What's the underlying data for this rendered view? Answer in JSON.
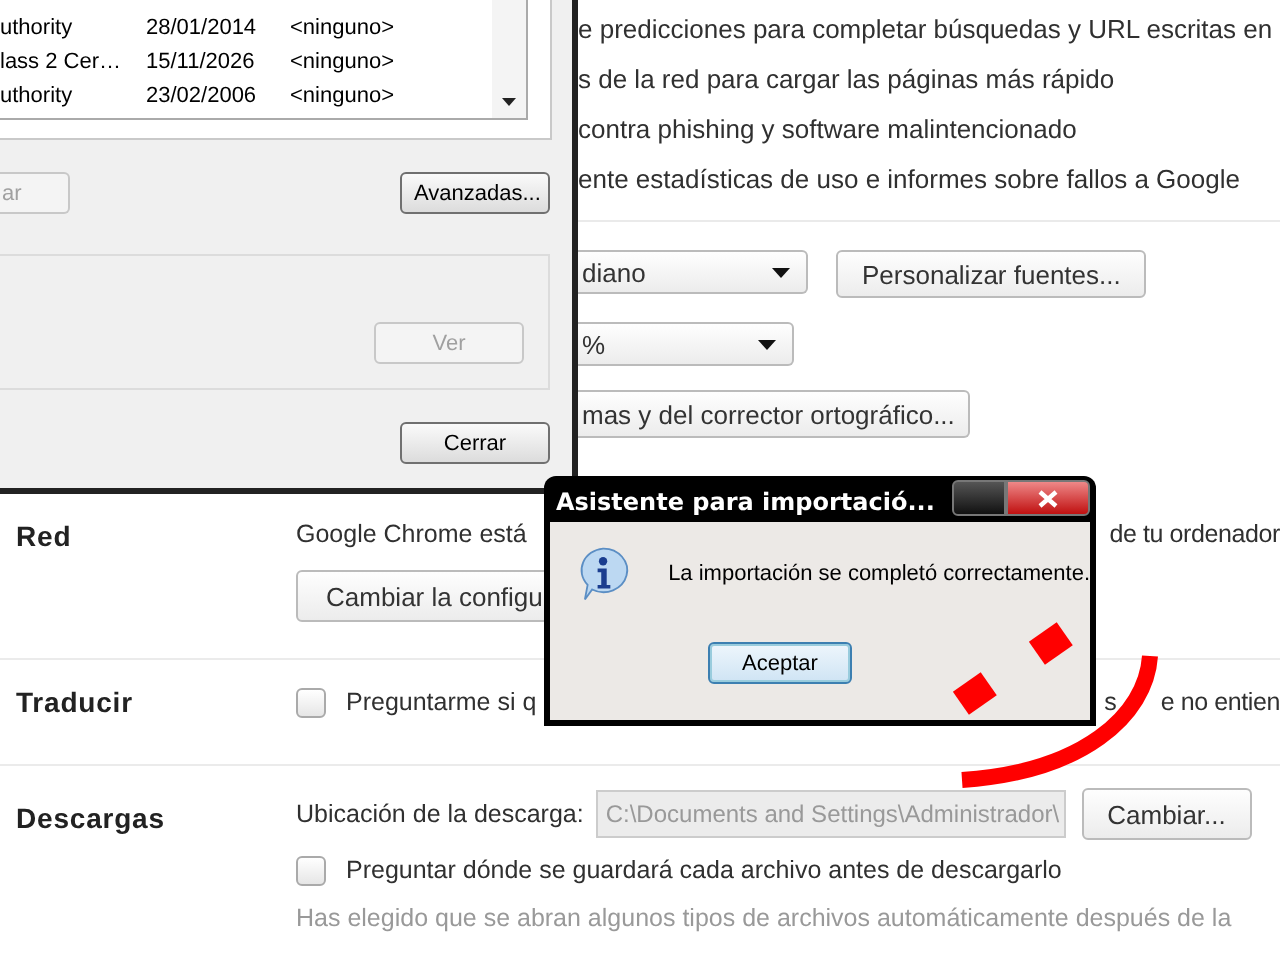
{
  "certificate_dialog": {
    "rows": [
      {
        "cells": [
          "uthority",
          "28/01/2014",
          "<ninguno>"
        ]
      },
      {
        "cells": [
          "lass 2 Cer…",
          "15/11/2026",
          "<ninguno>"
        ]
      },
      {
        "cells": [
          "uthority",
          "23/02/2006",
          "<ninguno>"
        ]
      }
    ],
    "left_button": {
      "label": "ar",
      "disabled": true
    },
    "advanced_button": {
      "label": "Avanzadas...",
      "disabled": false
    },
    "view_button": {
      "label": "Ver",
      "disabled": true
    },
    "close_button": {
      "label": "Cerrar",
      "disabled": false
    }
  },
  "settings_top": {
    "lines": [
      "e predicciones para completar búsquedas y URL escritas en",
      "s de la red para cargar las páginas más rápido",
      "contra phishing y software malintencionado",
      "ente estadísticas de uso e informes sobre fallos a Google"
    ],
    "font_size_select": "diano",
    "customize_fonts_button": "Personalizar fuentes...",
    "zoom_select": "%",
    "languages_button": "mas y del corrector ortográfico..."
  },
  "sections": [
    {
      "kind": "network",
      "label": "Red",
      "text_start": "Google Chrome está",
      "text_end": "de tu ordenador",
      "button": "Cambiar la configu"
    },
    {
      "kind": "translate",
      "label": "Traducir",
      "checkbox": {
        "label": "Preguntarme si q",
        "checked": false
      },
      "text_mid": "s",
      "text_end": "e no entien"
    },
    {
      "kind": "downloads",
      "label": "Descargas",
      "location_label": "Ubicación de la descarga:",
      "location_value": "C:\\Documents and Settings\\Administrador\\",
      "change_button": "Cambiar...",
      "checkbox": {
        "label": "Preguntar dónde se guardará cada archivo antes de descargarlo",
        "checked": false
      },
      "note": "Has elegido que se abran algunos tipos de archivos automáticamente después de la"
    }
  ],
  "import_dialog": {
    "title": "Asistente para importació...",
    "message": "La importación se completó correctamente.",
    "button": "Aceptar"
  }
}
